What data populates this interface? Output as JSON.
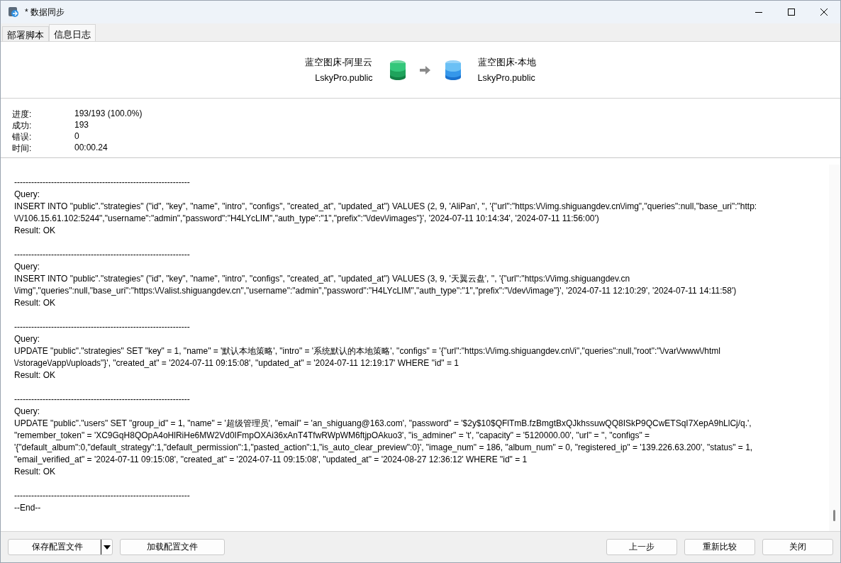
{
  "window": {
    "title": "* 数据同步"
  },
  "tabs": [
    {
      "label": "部署脚本",
      "selected": false
    },
    {
      "label": "信息日志",
      "selected": true
    }
  ],
  "source": {
    "connection": "蓝空图床-阿里云",
    "schema": "LskyPro.public"
  },
  "target": {
    "connection": "蓝空图床-本地",
    "schema": "LskyPro.public"
  },
  "stats": [
    {
      "label": "进度:",
      "value": "193/193 (100.0%)"
    },
    {
      "label": "成功:",
      "value": "193"
    },
    {
      "label": "错误:",
      "value": "0"
    },
    {
      "label": "时间:",
      "value": "00:00.24"
    }
  ],
  "log": [
    {
      "kind": "gap"
    },
    {
      "kind": "rule",
      "text": "--------------------------------------------------------------"
    },
    {
      "kind": "line",
      "text": "Query:"
    },
    {
      "kind": "line",
      "text": "INSERT INTO \"public\".\"strategies\" (\"id\", \"key\", \"name\", \"intro\", \"configs\", \"created_at\", \"updated_at\") VALUES (2, 9, 'AliPan', '', '{\"url\":\"https:\\/\\/img.shiguangdev.cn\\/img\",\"queries\":null,\"base_uri\":\"http:"
    },
    {
      "kind": "line",
      "text": "\\/\\/106.15.61.102:5244\",\"username\":\"admin\",\"password\":\"H4LYcLIM\",\"auth_type\":\"1\",\"prefix\":\"\\/dev\\/images\"}', '2024-07-11 10:14:34', '2024-07-11 11:56:00')"
    },
    {
      "kind": "line",
      "text": "Result: OK"
    },
    {
      "kind": "gap"
    },
    {
      "kind": "rule",
      "text": "--------------------------------------------------------------"
    },
    {
      "kind": "line",
      "text": "Query:"
    },
    {
      "kind": "line",
      "text": "INSERT INTO \"public\".\"strategies\" (\"id\", \"key\", \"name\", \"intro\", \"configs\", \"created_at\", \"updated_at\") VALUES (3, 9, '天翼云盘', '', '{\"url\":\"https:\\/\\/img.shiguangdev.cn"
    },
    {
      "kind": "line",
      "text": "\\/img\",\"queries\":null,\"base_uri\":\"https:\\/\\/alist.shiguangdev.cn\",\"username\":\"admin\",\"password\":\"H4LYcLIM\",\"auth_type\":\"1\",\"prefix\":\"\\/dev\\/image\"}', '2024-07-11 12:10:29', '2024-07-11 14:11:58')"
    },
    {
      "kind": "line",
      "text": "Result: OK"
    },
    {
      "kind": "gap"
    },
    {
      "kind": "rule",
      "text": "--------------------------------------------------------------"
    },
    {
      "kind": "line",
      "text": "Query:"
    },
    {
      "kind": "line",
      "text": "UPDATE \"public\".\"strategies\" SET \"key\" = 1, \"name\" = '默认本地策略', \"intro\" = '系统默认的本地策略', \"configs\" = '{\"url\":\"https:\\/\\/img.shiguangdev.cn\\/i\",\"queries\":null,\"root\":\"\\/var\\/www\\/html"
    },
    {
      "kind": "line",
      "text": "\\/storage\\/app\\/uploads\"}', \"created_at\" = '2024-07-11 09:15:08', \"updated_at\" = '2024-07-11 12:19:17' WHERE \"id\" = 1"
    },
    {
      "kind": "line",
      "text": "Result: OK"
    },
    {
      "kind": "gap"
    },
    {
      "kind": "rule",
      "text": "--------------------------------------------------------------"
    },
    {
      "kind": "line",
      "text": "Query:"
    },
    {
      "kind": "line",
      "text": "UPDATE \"public\".\"users\" SET \"group_id\" = 1, \"name\" = '超级管理员', \"email\" = 'an_shiguang@163.com', \"password\" = '$2y$10$QFlTmB.fzBmgtBxQJkhssuwQQ8ISkP9QCwETSqI7XepA9hLlCj/q.',"
    },
    {
      "kind": "line",
      "text": "\"remember_token\" = 'XC9GqH8QOpA4oHlRiHe6MW2Vd0IFmpOXAi36xAnT4TfwRWpWM6ftjpOAkuo3', \"is_adminer\" = 't', \"capacity\" = '5120000.00', \"url\" = '', \"configs\" ="
    },
    {
      "kind": "line",
      "text": "'{\"default_album\":0,\"default_strategy\":1,\"default_permission\":1,\"pasted_action\":1,\"is_auto_clear_preview\":0}', \"image_num\" = 186, \"album_num\" = 0, \"registered_ip\" = '139.226.63.200', \"status\" = 1,"
    },
    {
      "kind": "line",
      "text": "\"email_verified_at\" = '2024-07-11 09:15:08', \"created_at\" = '2024-07-11 09:15:08', \"updated_at\" = '2024-08-27 12:36:12' WHERE \"id\" = 1"
    },
    {
      "kind": "line",
      "text": "Result: OK"
    },
    {
      "kind": "gap"
    },
    {
      "kind": "rule",
      "text": "--------------------------------------------------------------"
    },
    {
      "kind": "line",
      "text": "--End--"
    }
  ],
  "footer": {
    "left_buttons": [
      {
        "label": "保存配置文件",
        "kind": "split"
      },
      {
        "label": "加载配置文件",
        "kind": "plain"
      }
    ],
    "right_buttons": [
      {
        "label": "上一步",
        "kind": "plain"
      },
      {
        "label": "重新比较",
        "kind": "plain"
      },
      {
        "label": "关闭",
        "kind": "plain"
      }
    ]
  }
}
